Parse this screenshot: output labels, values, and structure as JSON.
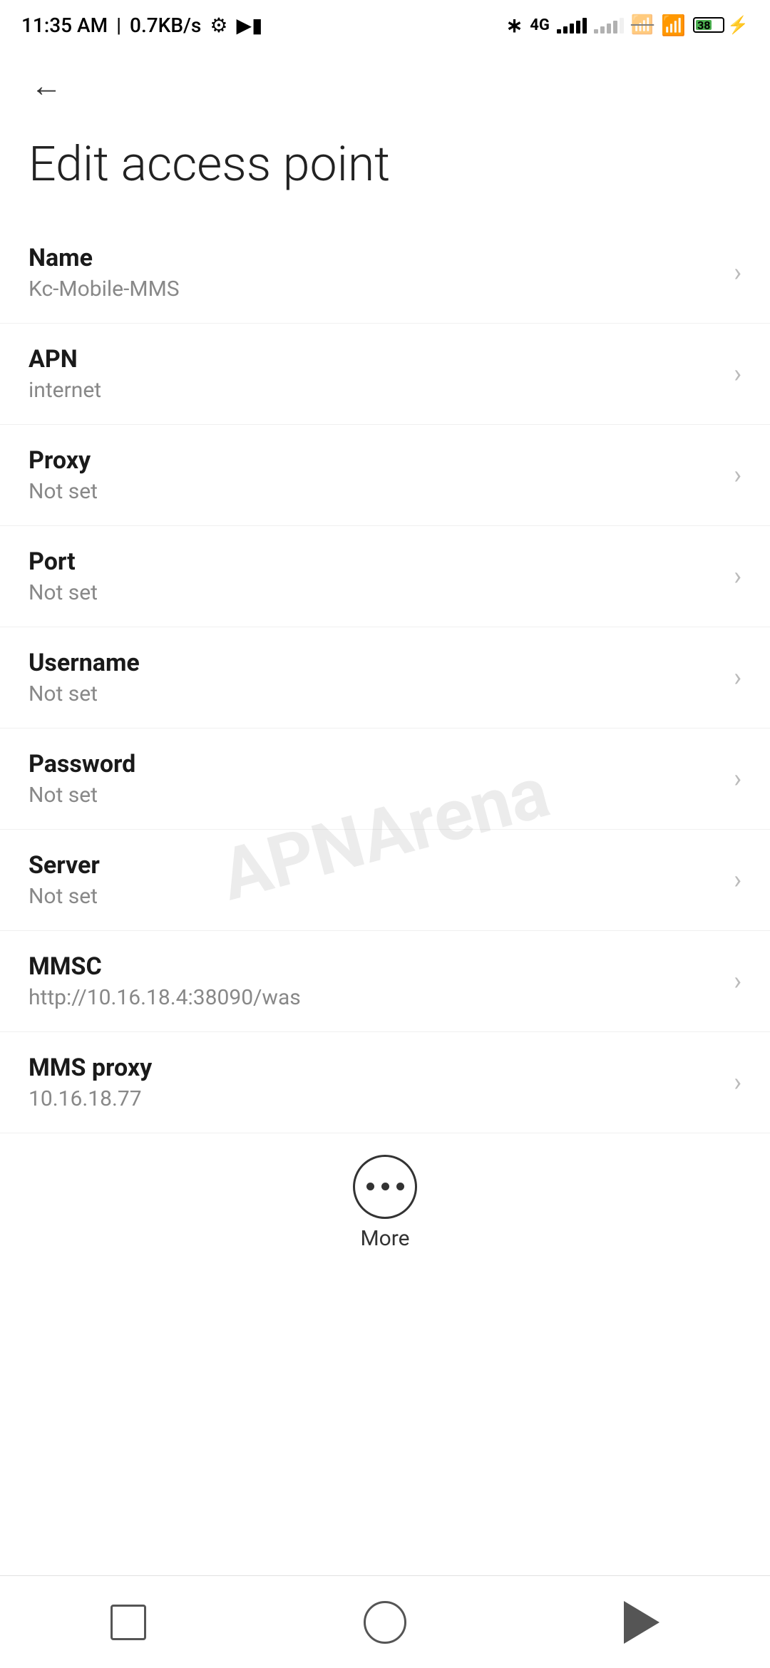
{
  "statusBar": {
    "time": "11:35 AM",
    "dataSpeed": "0.7KB/s",
    "battery": "38"
  },
  "navigation": {
    "backLabel": "←"
  },
  "page": {
    "title": "Edit access point"
  },
  "settings": [
    {
      "label": "Name",
      "value": "Kc-Mobile-MMS"
    },
    {
      "label": "APN",
      "value": "internet"
    },
    {
      "label": "Proxy",
      "value": "Not set"
    },
    {
      "label": "Port",
      "value": "Not set"
    },
    {
      "label": "Username",
      "value": "Not set"
    },
    {
      "label": "Password",
      "value": "Not set"
    },
    {
      "label": "Server",
      "value": "Not set"
    },
    {
      "label": "MMSC",
      "value": "http://10.16.18.4:38090/was"
    },
    {
      "label": "MMS proxy",
      "value": "10.16.18.77"
    }
  ],
  "more": {
    "label": "More"
  },
  "watermark": "APNArena"
}
